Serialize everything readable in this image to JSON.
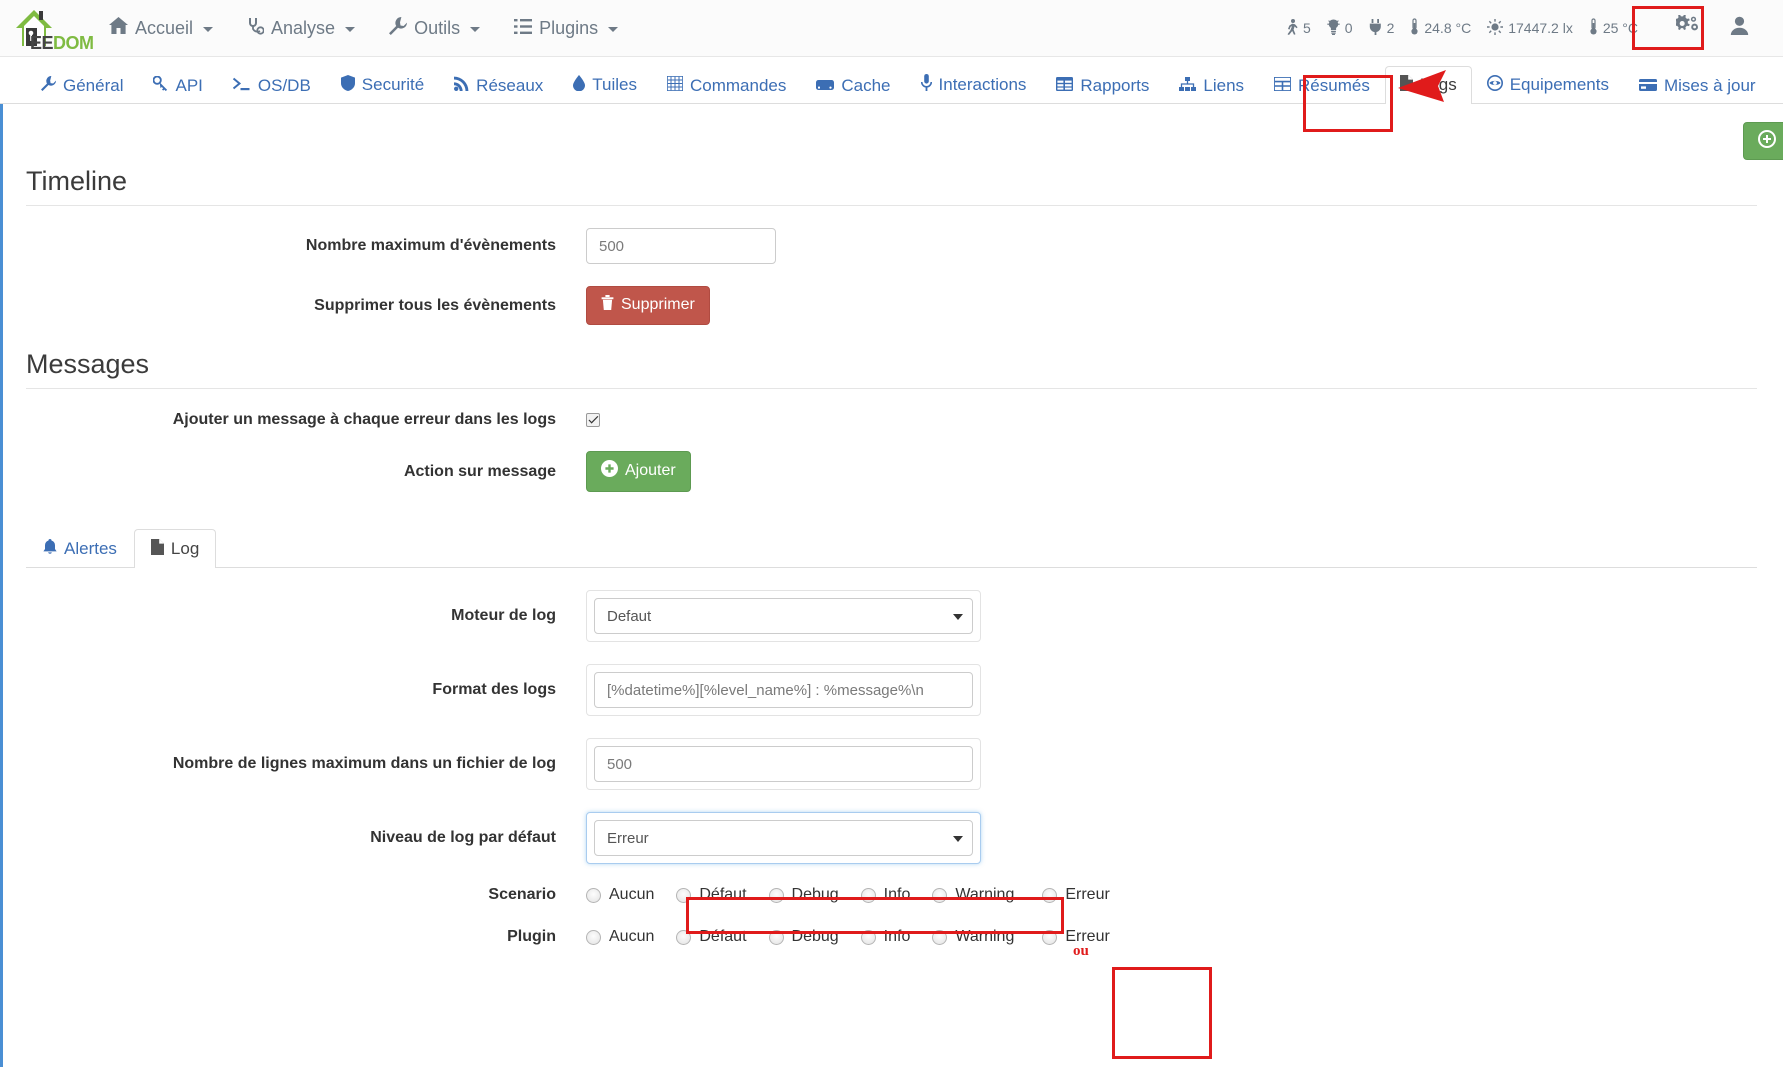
{
  "brand": {
    "dark": "EE",
    "green": "DOM"
  },
  "navbar": {
    "items": [
      {
        "label": "Accueil",
        "icon": "home-icon"
      },
      {
        "label": "Analyse",
        "icon": "stethoscope-icon"
      },
      {
        "label": "Outils",
        "icon": "wrench-icon"
      },
      {
        "label": "Plugins",
        "icon": "list-icon"
      }
    ],
    "stats": [
      {
        "icon": "person-walking-icon",
        "value": "5"
      },
      {
        "icon": "lightbulb-icon",
        "value": "0"
      },
      {
        "icon": "plug-icon",
        "value": "2"
      },
      {
        "icon": "thermometer-icon",
        "value": "24.8 °C"
      },
      {
        "icon": "sun-icon",
        "value": "17447.2 lx"
      },
      {
        "icon": "thermometer-icon",
        "value": "25 °C"
      }
    ],
    "gear_button": "gear-icon",
    "user_button": "user-icon"
  },
  "tabs": [
    {
      "label": "Général",
      "icon": "wrench-icon",
      "active": false
    },
    {
      "label": "API",
      "icon": "key-icon",
      "active": false
    },
    {
      "label": "OS/DB",
      "icon": "terminal-icon",
      "active": false
    },
    {
      "label": "Securité",
      "icon": "shield-icon",
      "active": false
    },
    {
      "label": "Réseaux",
      "icon": "rss-icon",
      "active": false
    },
    {
      "label": "Tuiles",
      "icon": "droplet-icon",
      "active": false
    },
    {
      "label": "Commandes",
      "icon": "grid-icon",
      "active": false
    },
    {
      "label": "Cache",
      "icon": "database-icon",
      "active": false
    },
    {
      "label": "Interactions",
      "icon": "microphone-icon",
      "active": false
    },
    {
      "label": "Rapports",
      "icon": "table-icon",
      "active": false
    },
    {
      "label": "Liens",
      "icon": "sitemap-icon",
      "active": false
    },
    {
      "label": "Résumés",
      "icon": "table-grid-icon",
      "active": false
    },
    {
      "label": "Logs",
      "icon": "file-icon",
      "active": true
    },
    {
      "label": "Equipements",
      "icon": "eye-circle-icon",
      "active": false
    },
    {
      "label": "Mises à jour",
      "icon": "card-icon",
      "active": false
    }
  ],
  "save_button": {
    "label": "",
    "icon": "save-icon"
  },
  "timeline": {
    "legend": "Timeline",
    "max_events_label": "Nombre maximum d'évènements",
    "max_events_value": "500",
    "delete_all_label": "Supprimer tous les évènements",
    "delete_button": "Supprimer"
  },
  "messages": {
    "legend": "Messages",
    "add_message_label": "Ajouter un message à chaque erreur dans les logs",
    "add_message_checked": true,
    "action_label": "Action sur message",
    "add_button": "Ajouter"
  },
  "inner_tabs": [
    {
      "label": "Alertes",
      "icon": "bell-icon",
      "active": false
    },
    {
      "label": "Log",
      "icon": "file-icon",
      "active": true
    }
  ],
  "log_form": {
    "engine_label": "Moteur de log",
    "engine_value": "Defaut",
    "format_label": "Format des logs",
    "format_value": "[%datetime%][%level_name%] : %message%\\n",
    "maxlines_label": "Nombre de lignes maximum dans un fichier de log",
    "maxlines_value": "500",
    "default_level_label": "Niveau de log par défaut",
    "default_level_value": "Erreur",
    "level_options": [
      "Aucun",
      "Défaut",
      "Debug",
      "Info",
      "Warning",
      "Erreur"
    ],
    "scenario_label": "Scenario",
    "plugin_label": "Plugin"
  },
  "annotations": {
    "ou_text": "ou",
    "accent_red": "#e01b1b"
  },
  "colors": {
    "brand_green": "#7fbb42",
    "link_blue": "#3c6eb4",
    "danger": "#c0564b",
    "success": "#6aab5c",
    "annotation": "#e01b1b"
  }
}
